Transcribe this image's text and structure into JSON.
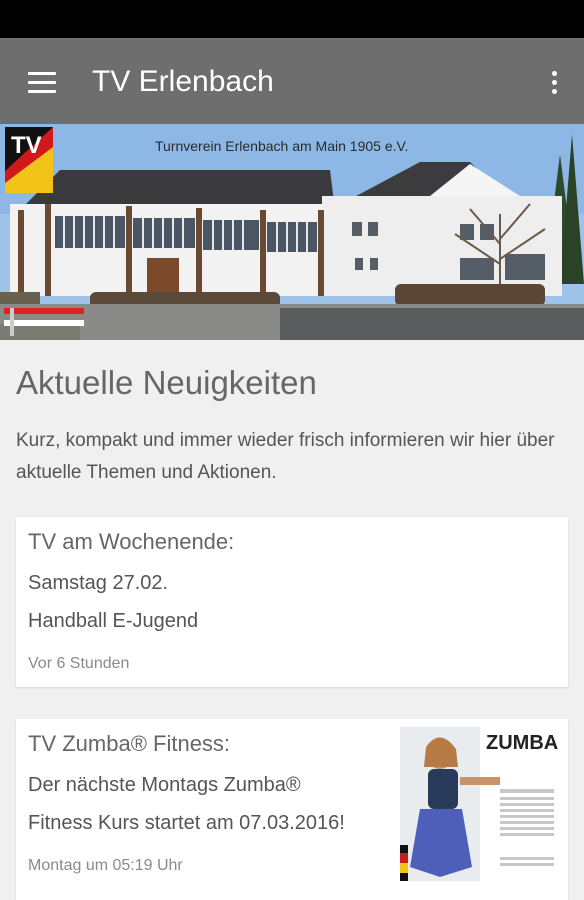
{
  "app_bar": {
    "title": "TV Erlenbach",
    "menu_icon": "hamburger-menu-icon",
    "overflow_icon": "overflow-menu-icon"
  },
  "hero": {
    "caption": "Turnverein Erlenbach am Main 1905 e.V.",
    "logo_text": "TV",
    "logo_year": "1905"
  },
  "section": {
    "title": "Aktuelle Neuigkeiten",
    "description": "Kurz, kompakt und immer wieder frisch informieren wir hier über aktuelle Themen und Aktionen."
  },
  "cards": [
    {
      "title": "TV am Wochenende:",
      "line1": "Samstag 27.02.",
      "line2": "Handball E-Jugend",
      "time": "Vor 6 Stunden"
    },
    {
      "title": "TV Zumba® Fitness:",
      "line1": "Der nächste Montags Zumba®",
      "line2": "Fitness Kurs startet am 07.03.2016!",
      "time": "Montag um 05:19 Uhr",
      "thumb_brand": "ZUMBA"
    }
  ],
  "colors": {
    "app_bar": "#6e6e6e",
    "status_bar": "#000000",
    "background": "#f0f0f0"
  }
}
